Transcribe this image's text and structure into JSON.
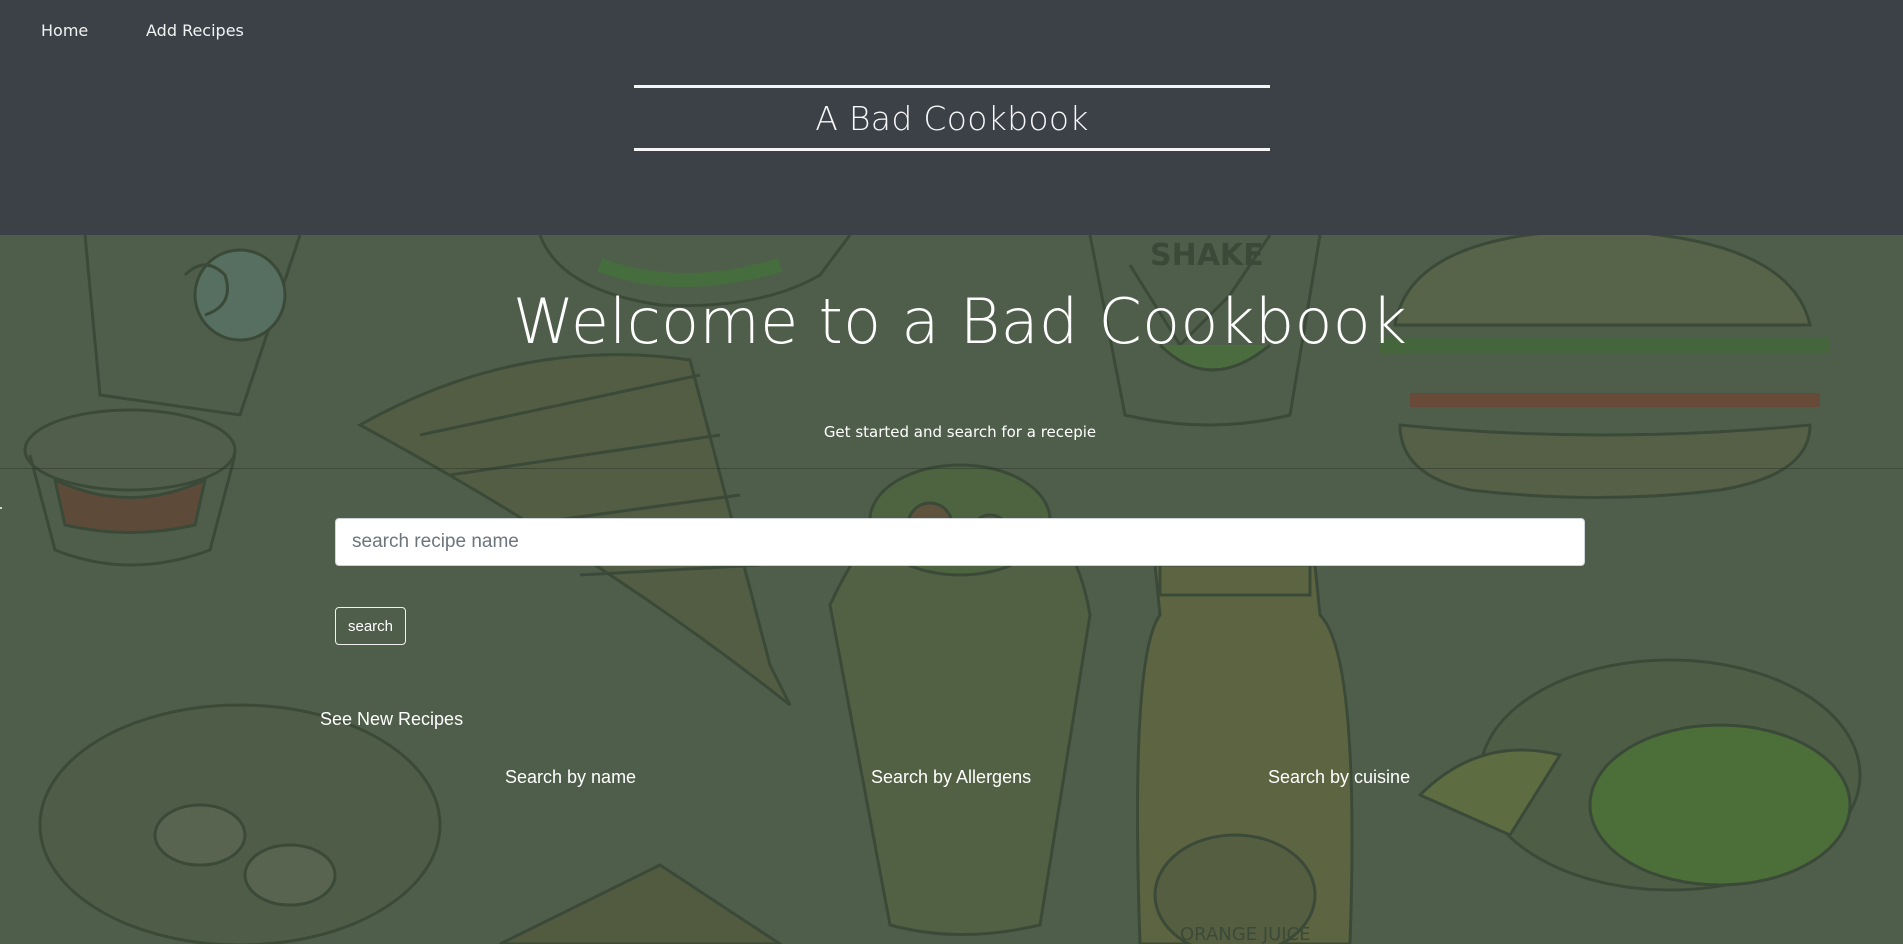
{
  "nav": {
    "home": "Home",
    "add_recipes": "Add Recipes"
  },
  "brand": {
    "title": "A Bad Cookbook"
  },
  "hero": {
    "heading": "Welcome to a Bad Cookbook",
    "subtitle": "Get started and search for a recepie",
    "search_placeholder": "search recipe name",
    "search_button": "search",
    "see_new": "See New Recipes",
    "links": {
      "by_name": "Search by name",
      "by_allergens": "Search by Allergens",
      "by_cuisine": "Search by cuisine"
    },
    "background_illustration": "food-doodles"
  },
  "colors": {
    "header_bg": "#3b4147",
    "hero_overlay": "#4f5e4b",
    "text": "#ffffff"
  }
}
